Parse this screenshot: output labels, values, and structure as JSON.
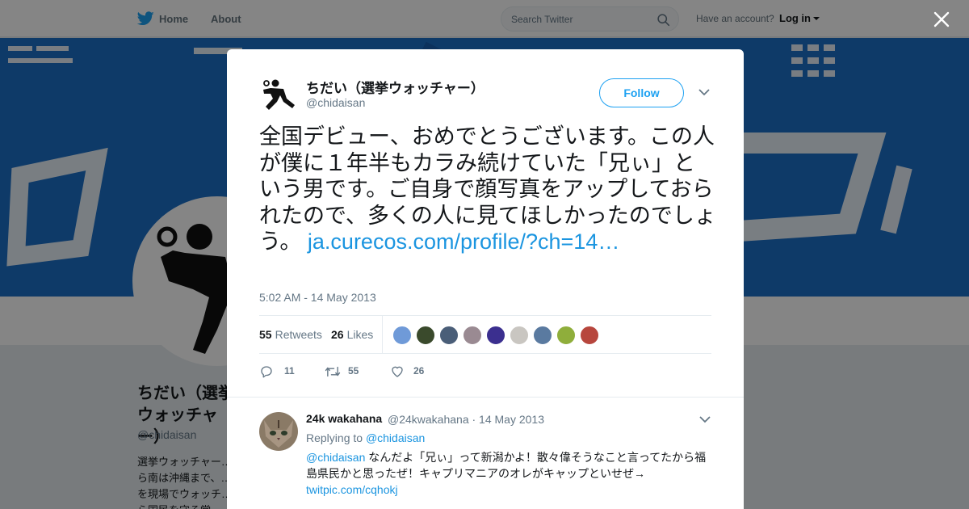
{
  "nav": {
    "home_label": "Home",
    "about_label": "About",
    "search_placeholder": "Search Twitter",
    "have_account": "Have an account?",
    "login_label": "Log in"
  },
  "profile": {
    "name": "ちだい（選挙ウォッチャー）",
    "handle": "@chidaisan",
    "bio": "選挙ウォッチャー…\nら南は沖縄まで、…\nを現場でウォッチ…\nら国民を守る堂…"
  },
  "tweet": {
    "author_name": "ちだい（選挙ウォッチャー）",
    "author_handle": "@chidaisan",
    "follow_label": "Follow",
    "text": "全国デビュー、おめでとうございます。この人が僕に１年半もカラみ続けていた「兄ぃ」という男です。ご自身で顔写真をアップしておられたので、多くの人に見てほしかったのでしょう。",
    "link_text": "ja.curecos.com/profile/?ch=14…",
    "timestamp": "5:02 AM - 14 May 2013",
    "retweets_count": "55",
    "retweets_label": "Retweets",
    "likes_count": "26",
    "likes_label": "Likes",
    "reply_action_count": "11",
    "retweet_action_count": "55",
    "like_action_count": "26"
  },
  "likers": [
    {
      "name": "liker-avatar-1",
      "color": "#6f9ad8"
    },
    {
      "name": "liker-avatar-2",
      "color": "#3a4a2c"
    },
    {
      "name": "liker-avatar-3",
      "color": "#4a5e78"
    },
    {
      "name": "liker-avatar-4",
      "color": "#9a8a92"
    },
    {
      "name": "liker-avatar-5",
      "color": "#3b2f8f"
    },
    {
      "name": "liker-avatar-6",
      "color": "#c9c6c1"
    },
    {
      "name": "liker-avatar-7",
      "color": "#5a7aa0"
    },
    {
      "name": "liker-avatar-8",
      "color": "#8fae3b"
    },
    {
      "name": "liker-avatar-9",
      "color": "#b7463d"
    }
  ],
  "reply": {
    "name": "24k wakahana",
    "handle_date": "@24kwakahana · 14 May 2013",
    "replying_to_label": "Replying to",
    "replying_to_handle": "@chidaisan",
    "mention": "@chidaisan",
    "text": "なんだよ「兄ぃ」って新潟かよ！散々偉そうなこと言ってたから福島県民かと思ったぜ！キャプリマニアのオレがキャップといせぜ→",
    "link_text": "twitpic.com/cqhokj"
  },
  "colors": {
    "accent": "#1da1f2",
    "link": "#1b95e0",
    "banner": "#1b6fc8"
  }
}
